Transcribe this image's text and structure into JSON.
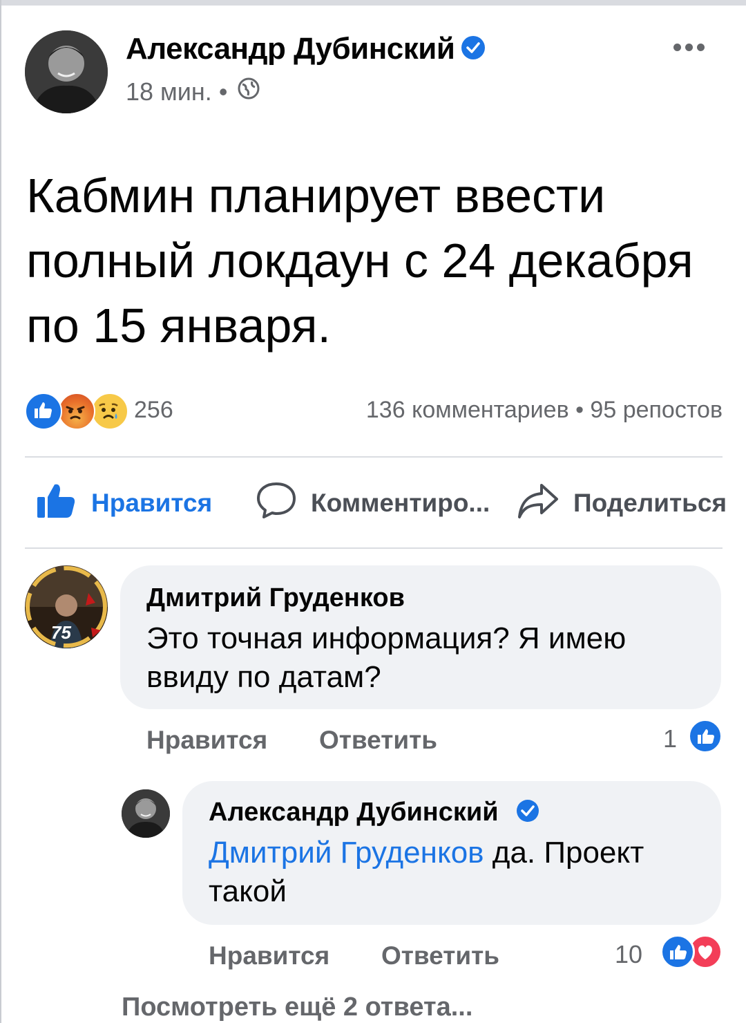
{
  "post": {
    "author": "Александр Дубинский",
    "time": "18 мин.",
    "separator": "•",
    "text": "Кабмин планирует ввести полный локдаун с 24 декабря по 15 января."
  },
  "stats": {
    "reactions_count": "256",
    "comments_shares": "136 комментариев • 95 репостов"
  },
  "actions": {
    "like": "Нравится",
    "comment": "Комментиро...",
    "share": "Поделиться"
  },
  "comments": [
    {
      "author": "Дмитрий Груденков",
      "text": "Это точная информация? Я имею ввиду по датам?",
      "like_label": "Нравится",
      "reply_label": "Ответить",
      "reaction_count": "1",
      "avatar_badge": "75"
    },
    {
      "author": "Александр Дубинский",
      "mention": "Дмитрий Груденков",
      "text": " да. Проект такой",
      "like_label": "Нравится",
      "reply_label": "Ответить",
      "reaction_count": "10"
    }
  ],
  "view_more": "Посмотреть ещё 2 ответа...",
  "colors": {
    "accent": "#1b74e4",
    "secondary_text": "#65676b",
    "bubble": "#f0f2f5",
    "love": "#f33e58"
  },
  "icons": [
    "verified-badge-icon",
    "globe-icon",
    "more-icon",
    "like-icon",
    "angry-icon",
    "sad-icon",
    "comment-icon",
    "share-icon",
    "love-icon"
  ]
}
